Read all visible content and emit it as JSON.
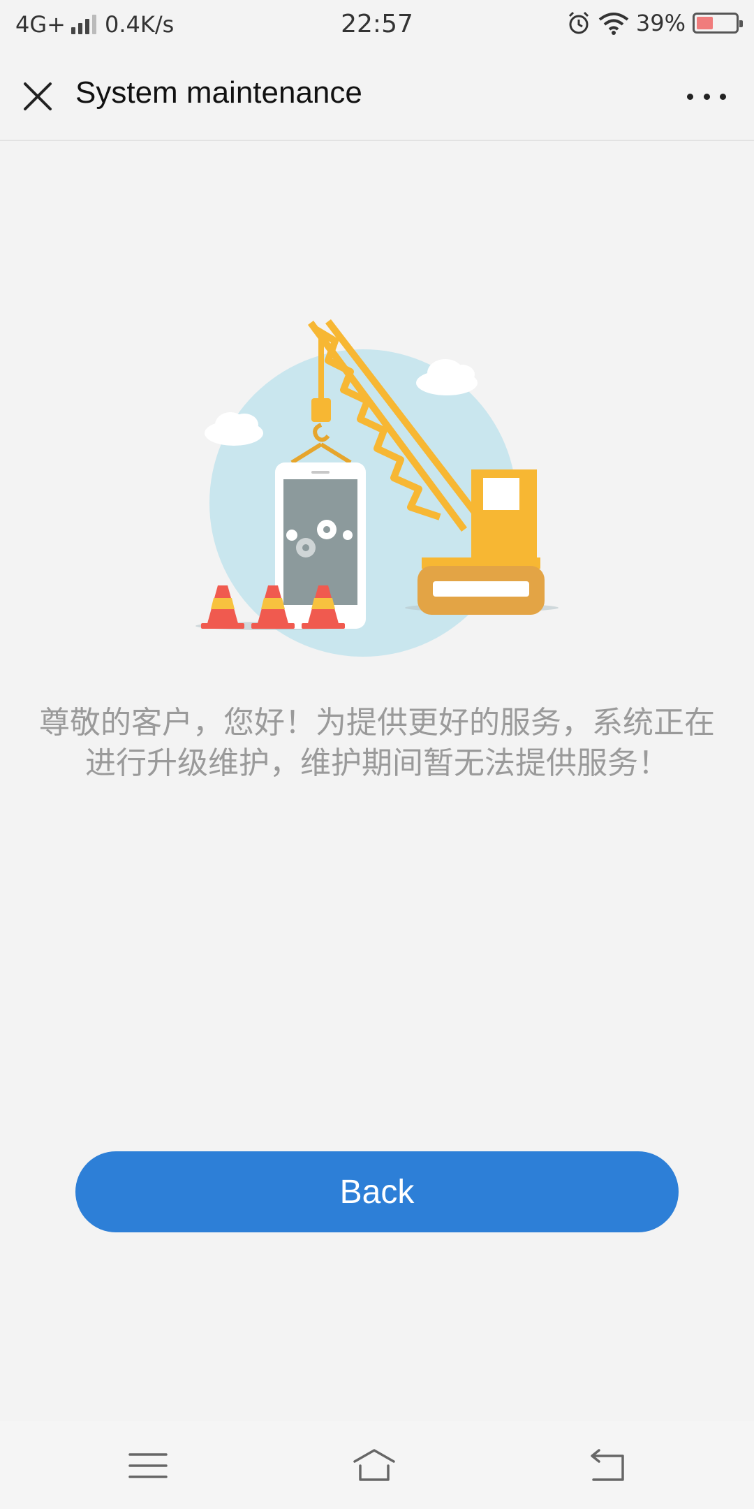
{
  "status_bar": {
    "network": "4G+",
    "speed": "0.4K/s",
    "time": "22:57",
    "battery": "39%",
    "battery_level": 0.39,
    "battery_color": "#f07c7c",
    "icons": [
      "signal-icon",
      "alarm-icon",
      "wifi-icon",
      "battery-icon"
    ]
  },
  "nav": {
    "title": "System maintenance",
    "close_icon": "close-icon",
    "more_icon": "more-icon"
  },
  "illustration": {
    "description_icon": "crane-maintenance-illustration",
    "colors": {
      "circle": "#c9e6ee",
      "crane": "#f7b733",
      "cone_red": "#f05a4f",
      "cone_yellow": "#f7c23f",
      "phone_screen": "#8c9a9c"
    }
  },
  "message": {
    "line1": "尊敬的客户，您好！为提供更好的服务，系统正在",
    "line2": "进行升级维护，维护期间暂无法提供服务！"
  },
  "back_button": {
    "label": "Back",
    "color": "#2d7fd7"
  },
  "system_nav": {
    "icons": [
      "menu-icon",
      "home-icon",
      "back-icon"
    ]
  }
}
